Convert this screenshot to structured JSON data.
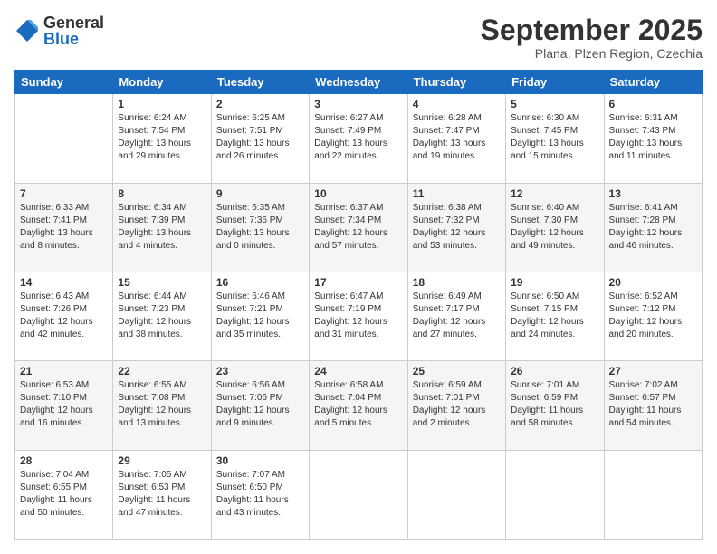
{
  "header": {
    "logo_general": "General",
    "logo_blue": "Blue",
    "month_title": "September 2025",
    "location": "Plana, Plzen Region, Czechia"
  },
  "days_of_week": [
    "Sunday",
    "Monday",
    "Tuesday",
    "Wednesday",
    "Thursday",
    "Friday",
    "Saturday"
  ],
  "weeks": [
    [
      {
        "day": "",
        "info": ""
      },
      {
        "day": "1",
        "info": "Sunrise: 6:24 AM\nSunset: 7:54 PM\nDaylight: 13 hours\nand 29 minutes."
      },
      {
        "day": "2",
        "info": "Sunrise: 6:25 AM\nSunset: 7:51 PM\nDaylight: 13 hours\nand 26 minutes."
      },
      {
        "day": "3",
        "info": "Sunrise: 6:27 AM\nSunset: 7:49 PM\nDaylight: 13 hours\nand 22 minutes."
      },
      {
        "day": "4",
        "info": "Sunrise: 6:28 AM\nSunset: 7:47 PM\nDaylight: 13 hours\nand 19 minutes."
      },
      {
        "day": "5",
        "info": "Sunrise: 6:30 AM\nSunset: 7:45 PM\nDaylight: 13 hours\nand 15 minutes."
      },
      {
        "day": "6",
        "info": "Sunrise: 6:31 AM\nSunset: 7:43 PM\nDaylight: 13 hours\nand 11 minutes."
      }
    ],
    [
      {
        "day": "7",
        "info": "Sunrise: 6:33 AM\nSunset: 7:41 PM\nDaylight: 13 hours\nand 8 minutes."
      },
      {
        "day": "8",
        "info": "Sunrise: 6:34 AM\nSunset: 7:39 PM\nDaylight: 13 hours\nand 4 minutes."
      },
      {
        "day": "9",
        "info": "Sunrise: 6:35 AM\nSunset: 7:36 PM\nDaylight: 13 hours\nand 0 minutes."
      },
      {
        "day": "10",
        "info": "Sunrise: 6:37 AM\nSunset: 7:34 PM\nDaylight: 12 hours\nand 57 minutes."
      },
      {
        "day": "11",
        "info": "Sunrise: 6:38 AM\nSunset: 7:32 PM\nDaylight: 12 hours\nand 53 minutes."
      },
      {
        "day": "12",
        "info": "Sunrise: 6:40 AM\nSunset: 7:30 PM\nDaylight: 12 hours\nand 49 minutes."
      },
      {
        "day": "13",
        "info": "Sunrise: 6:41 AM\nSunset: 7:28 PM\nDaylight: 12 hours\nand 46 minutes."
      }
    ],
    [
      {
        "day": "14",
        "info": "Sunrise: 6:43 AM\nSunset: 7:26 PM\nDaylight: 12 hours\nand 42 minutes."
      },
      {
        "day": "15",
        "info": "Sunrise: 6:44 AM\nSunset: 7:23 PM\nDaylight: 12 hours\nand 38 minutes."
      },
      {
        "day": "16",
        "info": "Sunrise: 6:46 AM\nSunset: 7:21 PM\nDaylight: 12 hours\nand 35 minutes."
      },
      {
        "day": "17",
        "info": "Sunrise: 6:47 AM\nSunset: 7:19 PM\nDaylight: 12 hours\nand 31 minutes."
      },
      {
        "day": "18",
        "info": "Sunrise: 6:49 AM\nSunset: 7:17 PM\nDaylight: 12 hours\nand 27 minutes."
      },
      {
        "day": "19",
        "info": "Sunrise: 6:50 AM\nSunset: 7:15 PM\nDaylight: 12 hours\nand 24 minutes."
      },
      {
        "day": "20",
        "info": "Sunrise: 6:52 AM\nSunset: 7:12 PM\nDaylight: 12 hours\nand 20 minutes."
      }
    ],
    [
      {
        "day": "21",
        "info": "Sunrise: 6:53 AM\nSunset: 7:10 PM\nDaylight: 12 hours\nand 16 minutes."
      },
      {
        "day": "22",
        "info": "Sunrise: 6:55 AM\nSunset: 7:08 PM\nDaylight: 12 hours\nand 13 minutes."
      },
      {
        "day": "23",
        "info": "Sunrise: 6:56 AM\nSunset: 7:06 PM\nDaylight: 12 hours\nand 9 minutes."
      },
      {
        "day": "24",
        "info": "Sunrise: 6:58 AM\nSunset: 7:04 PM\nDaylight: 12 hours\nand 5 minutes."
      },
      {
        "day": "25",
        "info": "Sunrise: 6:59 AM\nSunset: 7:01 PM\nDaylight: 12 hours\nand 2 minutes."
      },
      {
        "day": "26",
        "info": "Sunrise: 7:01 AM\nSunset: 6:59 PM\nDaylight: 11 hours\nand 58 minutes."
      },
      {
        "day": "27",
        "info": "Sunrise: 7:02 AM\nSunset: 6:57 PM\nDaylight: 11 hours\nand 54 minutes."
      }
    ],
    [
      {
        "day": "28",
        "info": "Sunrise: 7:04 AM\nSunset: 6:55 PM\nDaylight: 11 hours\nand 50 minutes."
      },
      {
        "day": "29",
        "info": "Sunrise: 7:05 AM\nSunset: 6:53 PM\nDaylight: 11 hours\nand 47 minutes."
      },
      {
        "day": "30",
        "info": "Sunrise: 7:07 AM\nSunset: 6:50 PM\nDaylight: 11 hours\nand 43 minutes."
      },
      {
        "day": "",
        "info": ""
      },
      {
        "day": "",
        "info": ""
      },
      {
        "day": "",
        "info": ""
      },
      {
        "day": "",
        "info": ""
      }
    ]
  ]
}
